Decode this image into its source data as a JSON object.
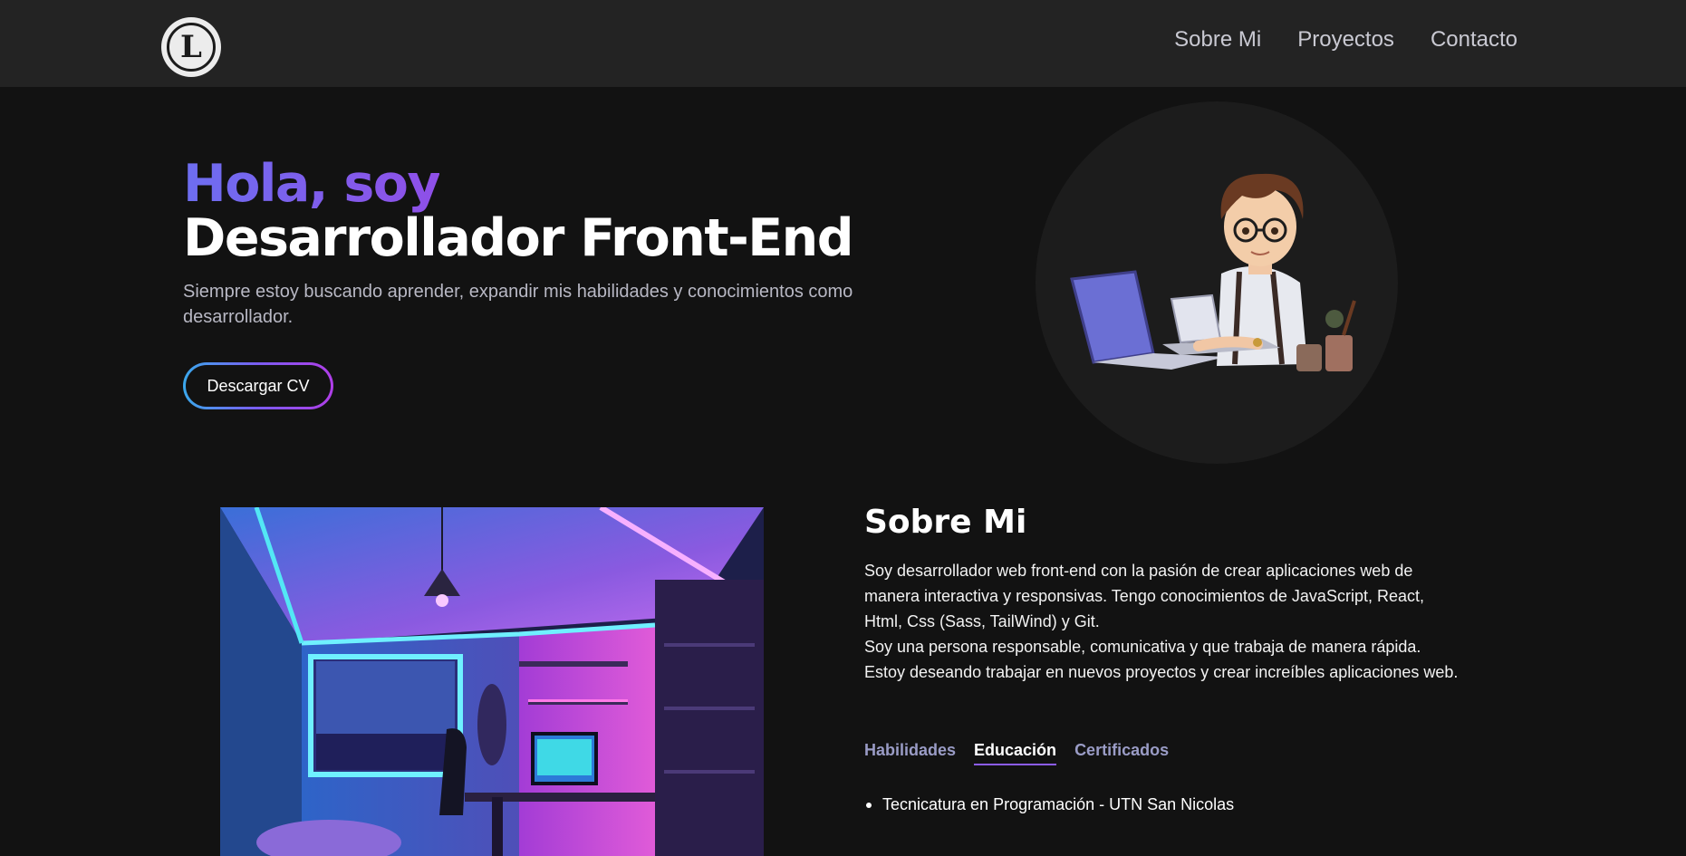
{
  "nav": {
    "logo_letter": "L",
    "links": [
      "Sobre Mi",
      "Proyectos",
      "Contacto"
    ]
  },
  "hero": {
    "greeting": "Hola, soy",
    "title": "Desarrollador Front-End",
    "subtitle": "Siempre estoy buscando aprender, expandir mis habilidades y conocimientos como desarrollador.",
    "cv_button": "Descargar CV"
  },
  "about": {
    "title": "Sobre Mi",
    "paragraph_1": "Soy desarrollador web front-end con la pasión de crear aplicaciones web de manera interactiva y responsivas. Tengo conocimientos de JavaScript, React, Html, Css (Sass, TailWind) y Git.",
    "paragraph_2": "Soy una persona responsable, comunicativa y que trabaja de manera rápida. Estoy deseando trabajar en nuevos proyectos y crear increíbles aplicaciones web.",
    "tabs": [
      {
        "label": "Habilidades",
        "active": false
      },
      {
        "label": "Educación",
        "active": true
      },
      {
        "label": "Certificados",
        "active": false
      }
    ],
    "education": [
      "Tecnicatura en Programación - UTN San Nicolas"
    ]
  },
  "colors": {
    "background": "#121212",
    "nav_background": "#232323",
    "accent_purple": "#8f4fe8",
    "accent_blue": "#3aa8ec"
  }
}
